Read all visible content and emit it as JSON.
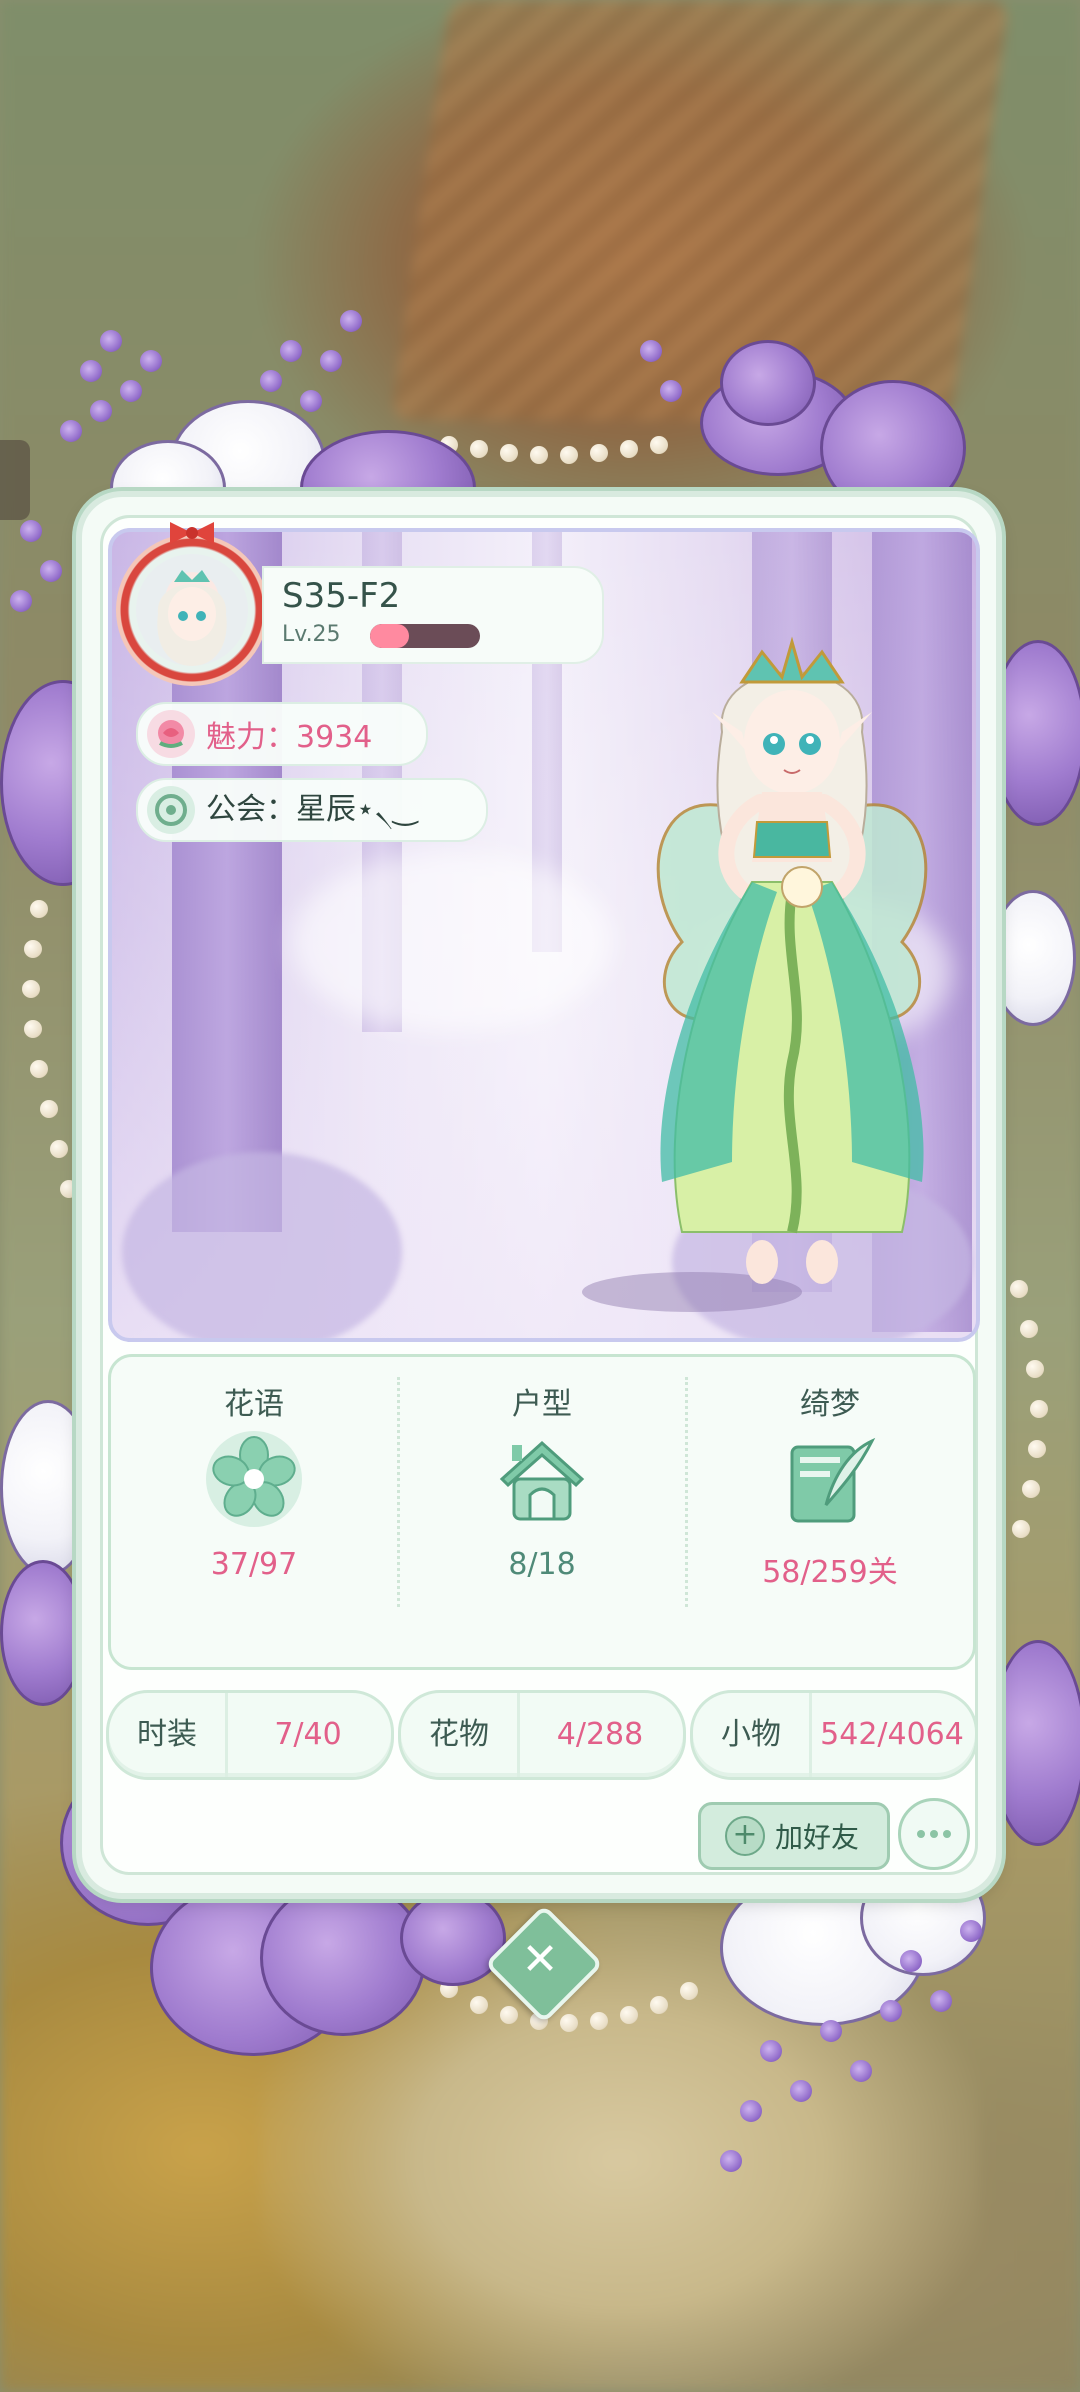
{
  "player": {
    "name": "S35-F2",
    "level": "Lv.25",
    "xp_fraction": 0.35
  },
  "charm": {
    "label": "魅力：3934"
  },
  "guild": {
    "label": "公会：星辰⋆৲‿"
  },
  "stats": [
    {
      "label": "花语",
      "value": "37/97",
      "icon": "flower-icon",
      "color": "#e2608a"
    },
    {
      "label": "户型",
      "value": "8/18",
      "icon": "house-icon",
      "color": "#4f8a78"
    },
    {
      "label": "绮梦",
      "value": "58/259关",
      "icon": "dream-letter-icon",
      "color": "#e2608a"
    }
  ],
  "collections": [
    {
      "label": "时装",
      "value": "7/40"
    },
    {
      "label": "花物",
      "value": "4/288"
    },
    {
      "label": "小物",
      "value": "542/4064"
    }
  ],
  "actions": {
    "add_friend": "加好友",
    "more": "more-icon",
    "close": "close-icon"
  },
  "colors": {
    "accent_green": "#7fbf9a",
    "accent_pink": "#e2608a",
    "frame_purple": "#a07ccf"
  }
}
